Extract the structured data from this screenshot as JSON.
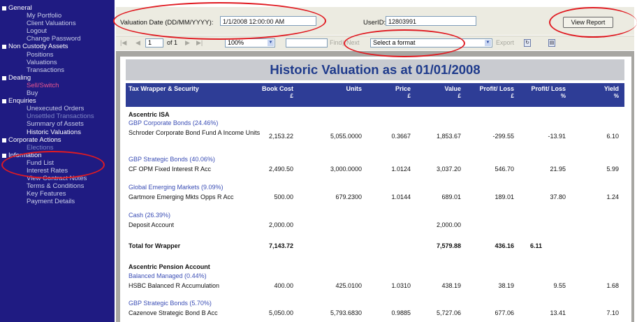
{
  "sidebar": {
    "general": {
      "label": "General",
      "items": [
        "My Portfolio",
        "Client Valuations",
        "Logout",
        "Change Password"
      ]
    },
    "non_custody": {
      "label": "Non Custody Assets",
      "items": [
        "Positions",
        "Valuations",
        "Transactions"
      ]
    },
    "dealing": {
      "label": "Dealing",
      "items": [
        "Sell/Switch",
        "Buy"
      ]
    },
    "enquiries": {
      "label": "Enquiries",
      "items": [
        "Unexecuted Orders",
        "Unsettled Transactions",
        "Summary of Assets",
        "Historic Valuations"
      ]
    },
    "corporate": {
      "label": "Corporate Actions",
      "items": [
        "Elections"
      ]
    },
    "information": {
      "label": "Information",
      "items": [
        "Fund List",
        "Interest Rates",
        "View Contract Notes",
        "Terms & Conditions",
        "Key Features",
        "Payment Details"
      ]
    }
  },
  "params": {
    "valuation_label": "Valuation Date (DD/MM/YYYY):",
    "valuation_value": "1/1/2008 12:00:00 AM",
    "userid_label": "UserID:",
    "userid_value": "12803991",
    "view_report": "View Report"
  },
  "toolbar": {
    "page_value": "1",
    "of_label": "of 1",
    "zoom": "100%",
    "find": "Find",
    "next": "Next",
    "format": "Select a format",
    "export": "Export"
  },
  "report": {
    "title": "Historic Valuation as at 01/01/2008",
    "columns": {
      "security": "Tax Wrapper & Security",
      "book_cost": "Book Cost",
      "units": "Units",
      "price": "Price",
      "value": "Value",
      "profit": "Profit/ Loss",
      "profit_pct": "Profit/ Loss",
      "yield": "Yield",
      "currency_unit": "£",
      "pct_unit": "%"
    },
    "wrappers": [
      {
        "name": "Ascentric ISA",
        "groups": [
          {
            "category": "GBP Corporate Bonds (24.46%)",
            "security": "Schroder Corporate Bond Fund A Income Units",
            "book_cost": "2,153.22",
            "units": "5,055.0000",
            "price": "0.3667",
            "value": "1,853.67",
            "profit": "-299.55",
            "profit_pct": "-13.91",
            "yield": "6.10"
          },
          {
            "category": "GBP Strategic Bonds (40.06%)",
            "security": "CF OPM Fixed Interest R Acc",
            "book_cost": "2,490.50",
            "units": "3,000.0000",
            "price": "1.0124",
            "value": "3,037.20",
            "profit": "546.70",
            "profit_pct": "21.95",
            "yield": "5.99"
          },
          {
            "category": "Global Emerging Markets (9.09%)",
            "security": "Gartmore Emerging Mkts Opps R Acc",
            "book_cost": "500.00",
            "units": "679.2300",
            "price": "1.0144",
            "value": "689.01",
            "profit": "189.01",
            "profit_pct": "37.80",
            "yield": "1.24"
          },
          {
            "category": "Cash (26.39%)",
            "security": "Deposit Account",
            "book_cost": "2,000.00",
            "units": "",
            "price": "",
            "value": "2,000.00",
            "profit": "",
            "profit_pct": "",
            "yield": ""
          }
        ],
        "total": {
          "label": "Total for Wrapper",
          "book_cost": "7,143.72",
          "value": "7,579.88",
          "profit": "436.16",
          "profit_pct": "6.11"
        }
      },
      {
        "name": "Ascentric Pension Account",
        "groups": [
          {
            "category": "Balanced Managed (0.44%)",
            "security": "HSBC Balanced R Accumulation",
            "book_cost": "400.00",
            "units": "425.0100",
            "price": "1.0310",
            "value": "438.19",
            "profit": "38.19",
            "profit_pct": "9.55",
            "yield": "1.68"
          },
          {
            "category": "GBP Strategic Bonds (5.70%)",
            "security": "Cazenove Strategic Bond B Acc",
            "book_cost": "5,050.00",
            "units": "5,793.6830",
            "price": "0.9885",
            "value": "5,727.06",
            "profit": "677.06",
            "profit_pct": "13.41",
            "yield": "7.10"
          }
        ]
      }
    ]
  },
  "colors": {
    "sidebar_bg": "#1f1b82",
    "active_item": "#e8558f",
    "header_bg": "#2e3d96",
    "title_text": "#1f3b8c",
    "category_text": "#3a4db5",
    "annotation": "#e01b22"
  }
}
